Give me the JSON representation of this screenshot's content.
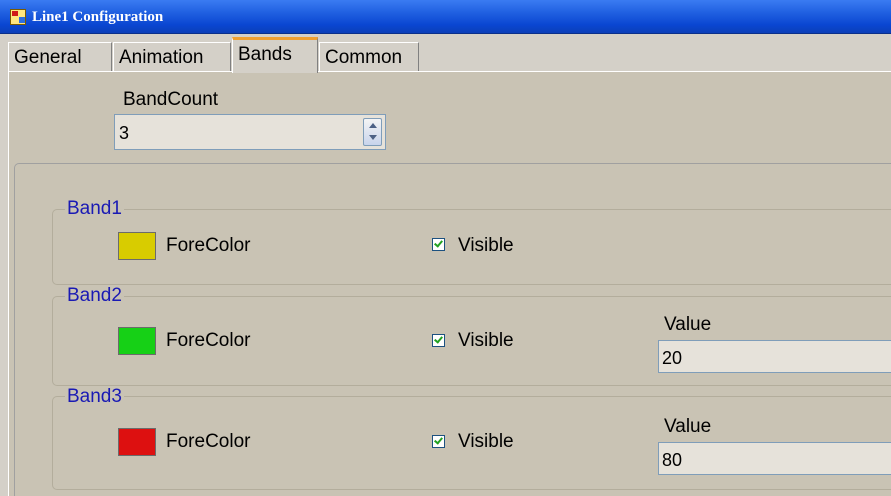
{
  "window": {
    "title": "Line1 Configuration"
  },
  "tabs": [
    {
      "label": "General"
    },
    {
      "label": "Animation"
    },
    {
      "label": "Bands"
    },
    {
      "label": "Common"
    }
  ],
  "active_tab": "Bands",
  "band_count": {
    "label": "BandCount",
    "value": "3"
  },
  "bands": [
    {
      "title": "Band1",
      "forecolor_label": "ForeColor",
      "forecolor": "#d8cc00",
      "visible_label": "Visible",
      "visible": true
    },
    {
      "title": "Band2",
      "forecolor_label": "ForeColor",
      "forecolor": "#16d016",
      "visible_label": "Visible",
      "visible": true,
      "value_label": "Value",
      "value": "20"
    },
    {
      "title": "Band3",
      "forecolor_label": "ForeColor",
      "forecolor": "#dd1010",
      "visible_label": "Visible",
      "visible": true,
      "value_label": "Value",
      "value": "80"
    }
  ]
}
